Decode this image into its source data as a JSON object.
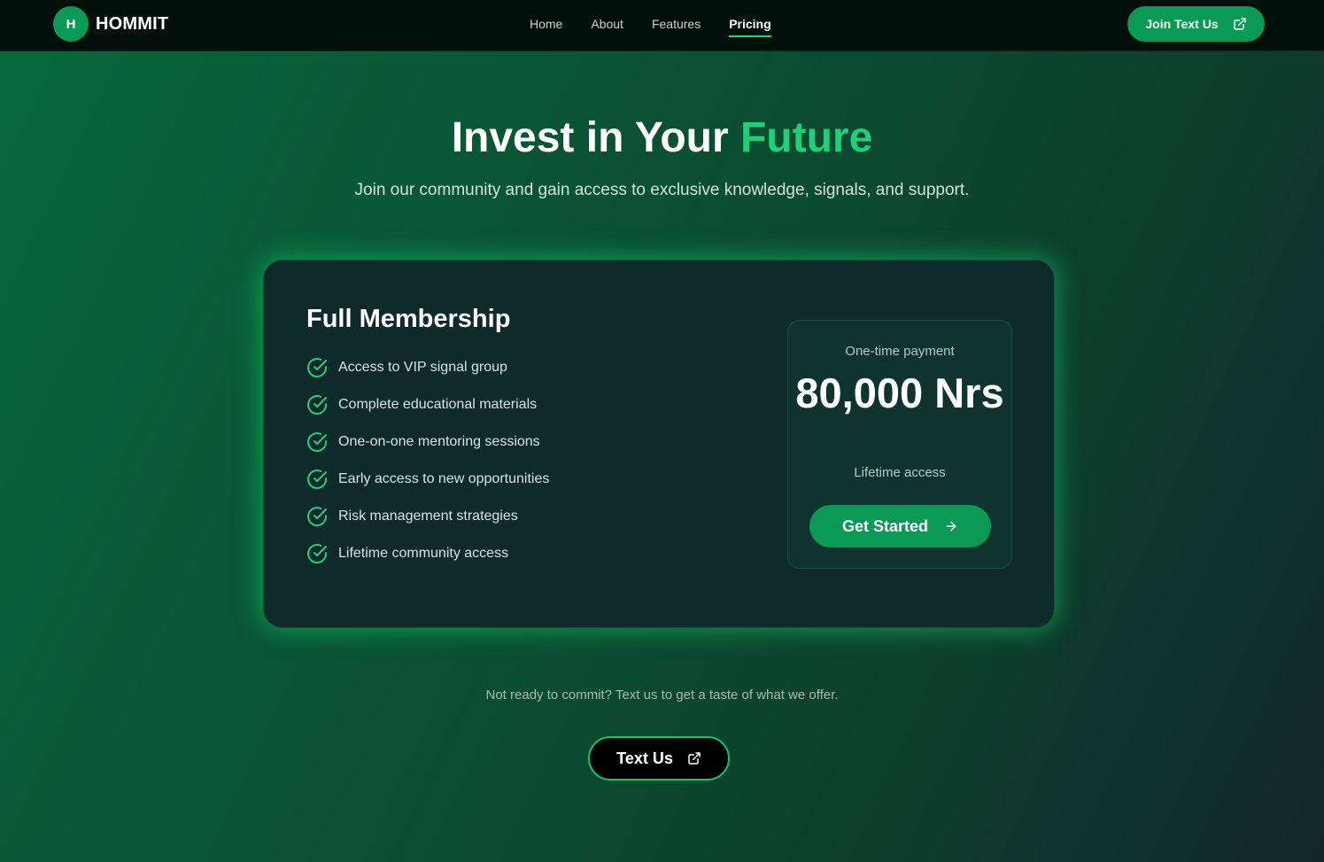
{
  "brand": {
    "logo_letter": "H",
    "name": "HOMMIT"
  },
  "nav": {
    "links": [
      {
        "label": "Home"
      },
      {
        "label": "About"
      },
      {
        "label": "Features"
      },
      {
        "label": "Pricing",
        "active": true
      }
    ],
    "cta_label": "Join Text Us",
    "cta_icon": "external-link-icon"
  },
  "hero": {
    "title_main": "Invest in Your ",
    "title_accent": "Future",
    "subtitle": "Join our community and gain access to exclusive knowledge, signals, and support."
  },
  "plan": {
    "title": "Full Membership",
    "features": [
      "Access to VIP signal group",
      "Complete educational materials",
      "One-on-one mentoring sessions",
      "Early access to new opportunities",
      "Risk management strategies",
      "Lifetime community access"
    ],
    "feature_icon": "check-circle-icon",
    "price_label": "One-time payment",
    "price_amount": "80,000 Nrs",
    "price_note": "Lifetime access",
    "cta_label": "Get Started",
    "cta_icon": "arrow-right-icon"
  },
  "footer_cta": {
    "note": "Not ready to commit? Text us to get a taste of what we offer.",
    "button_label": "Text Us",
    "button_icon": "external-link-icon"
  },
  "colors": {
    "accent": "#1fd07a",
    "button_green": "#0a9a55",
    "navbar_bg": "#02100b",
    "card_bg": "#0f2a2a"
  }
}
